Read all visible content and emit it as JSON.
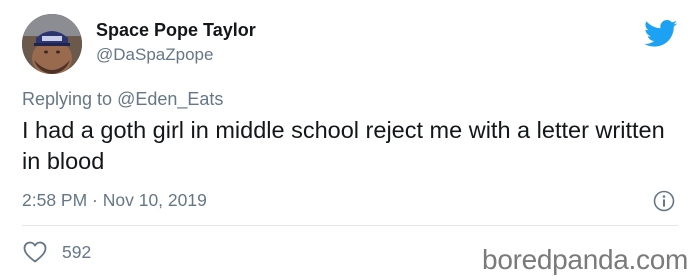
{
  "author": {
    "display_name": "Space Pope Taylor",
    "handle": "@DaSpaZpope"
  },
  "reply": {
    "prefix": "Replying to",
    "mention": "@Eden_Eats"
  },
  "tweet": {
    "text": "I had a goth girl in middle school reject me with a letter written in blood",
    "timestamp": "2:58 PM · Nov 10, 2019"
  },
  "engagement": {
    "likes": "592"
  },
  "icons": {
    "brand": "twitter-bird-icon",
    "info": "info-icon",
    "like": "heart-icon"
  },
  "watermark": {
    "text": "boredpanda.com"
  },
  "colors": {
    "brand_blue": "#1da1f2",
    "secondary_text": "#657786",
    "primary_text": "#14171a",
    "divider": "#e1e8ed",
    "watermark": "#7a7a7a"
  }
}
